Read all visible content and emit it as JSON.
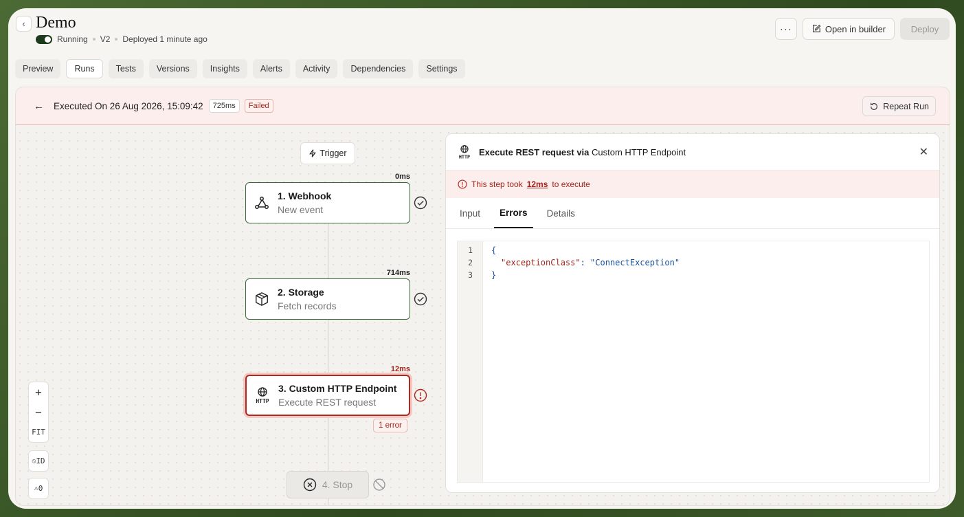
{
  "header": {
    "back_icon": "chevron-left-icon",
    "title": "Demo",
    "status": "Running",
    "version": "V2",
    "deployed": "Deployed 1 minute ago",
    "more_label": "···",
    "open_builder": "Open in builder",
    "deploy": "Deploy"
  },
  "tabs": [
    {
      "label": "Preview"
    },
    {
      "label": "Runs",
      "active": true
    },
    {
      "label": "Tests"
    },
    {
      "label": "Versions"
    },
    {
      "label": "Insights"
    },
    {
      "label": "Alerts"
    },
    {
      "label": "Activity"
    },
    {
      "label": "Dependencies"
    },
    {
      "label": "Settings"
    }
  ],
  "run": {
    "executed": "Executed On 26 Aug 2026, 15:09:42",
    "duration": "725ms",
    "status": "Failed",
    "repeat": "Repeat Run"
  },
  "flow": {
    "trigger": "Trigger",
    "steps": [
      {
        "title": "1. Webhook",
        "subtitle": "New event",
        "duration": "0ms",
        "status": "success"
      },
      {
        "title": "2. Storage",
        "subtitle": "Fetch records",
        "duration": "714ms",
        "status": "success"
      },
      {
        "title": "3. Custom HTTP Endpoint",
        "subtitle": "Execute REST request",
        "duration": "12ms",
        "status": "error",
        "errors": "1 error"
      },
      {
        "title": "4. Stop",
        "status": "skipped"
      }
    ]
  },
  "zoom": {
    "zoom_in": "+",
    "zoom_out": "−",
    "fit": "FIT",
    "id": "ID",
    "warnings": "0"
  },
  "panel": {
    "title_bold": "Execute REST request via",
    "title_rest": "Custom HTTP Endpoint",
    "error_prefix": "This step took",
    "error_time": "12ms",
    "error_suffix": "to execute",
    "tabs": [
      "Input",
      "Errors",
      "Details"
    ],
    "active_tab": "Errors",
    "code_lines": [
      {
        "n": "1",
        "text": "{"
      },
      {
        "n": "2",
        "key": "\"exceptionClass\"",
        "value": "\"ConnectException\""
      },
      {
        "n": "3",
        "text": "}"
      }
    ]
  },
  "colors": {
    "accent_green": "#3c6b3a",
    "error_red": "#b3261e",
    "error_bg": "#fbeeec"
  }
}
